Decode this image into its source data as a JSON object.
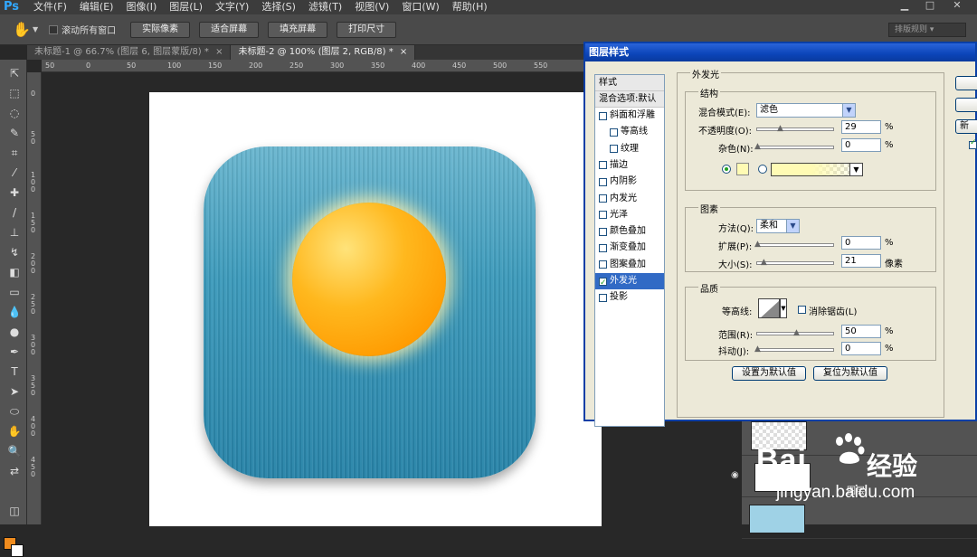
{
  "app": {
    "logo": "Ps",
    "win_min": "▁",
    "win_max": "□",
    "win_close": "✕"
  },
  "menu": [
    "文件(F)",
    "编辑(E)",
    "图像(I)",
    "图层(L)",
    "文字(Y)",
    "选择(S)",
    "滤镜(T)",
    "视图(V)",
    "窗口(W)",
    "帮助(H)"
  ],
  "options": {
    "scroll_all_windows": "滚动所有窗口",
    "actual_pixels": "实际像素",
    "fit_screen": "适合屏幕",
    "fill_screen": "填充屏幕",
    "print_size": "打印尺寸",
    "workspace": "排版规则"
  },
  "tabs": [
    {
      "label": "未标题-1 @ 66.7% (图层 6, 图层蒙版/8) *",
      "close": "×",
      "active": false
    },
    {
      "label": "未标题-2 @ 100% (图层 2, RGB/8) *",
      "close": "×",
      "active": true
    }
  ],
  "ruler": {
    "top": [
      "50",
      "0",
      "50",
      "100",
      "150",
      "200",
      "250",
      "300",
      "350",
      "400",
      "450",
      "500",
      "550"
    ],
    "left": [
      "0",
      "5 0",
      "1 0 0",
      "1 5 0",
      "2 0 0",
      "2 5 0",
      "3 0 0",
      "3 5 0",
      "4 0 0",
      "4 5 0"
    ]
  },
  "colors": {
    "foreground": "#f08c1e",
    "background": "#ffffff",
    "tile": "#2f8db3",
    "sun": "#ffa60a"
  },
  "dialog": {
    "title": "图层样式",
    "styles_header": "样式",
    "blend_options": "混合选项:默认",
    "styles": [
      {
        "label": "斜面和浮雕",
        "checked": false,
        "sub": false,
        "selected": false
      },
      {
        "label": "等高线",
        "checked": false,
        "sub": true,
        "selected": false
      },
      {
        "label": "纹理",
        "checked": false,
        "sub": true,
        "selected": false
      },
      {
        "label": "描边",
        "checked": false,
        "sub": false,
        "selected": false
      },
      {
        "label": "内阴影",
        "checked": false,
        "sub": false,
        "selected": false
      },
      {
        "label": "内发光",
        "checked": false,
        "sub": false,
        "selected": false
      },
      {
        "label": "光泽",
        "checked": false,
        "sub": false,
        "selected": false
      },
      {
        "label": "颜色叠加",
        "checked": false,
        "sub": false,
        "selected": false
      },
      {
        "label": "渐变叠加",
        "checked": false,
        "sub": false,
        "selected": false
      },
      {
        "label": "图案叠加",
        "checked": false,
        "sub": false,
        "selected": false
      },
      {
        "label": "外发光",
        "checked": true,
        "sub": false,
        "selected": true
      },
      {
        "label": "投影",
        "checked": false,
        "sub": false,
        "selected": false
      }
    ],
    "section_title": "外发光",
    "structure": {
      "title": "结构",
      "blend_mode_label": "混合模式(E):",
      "blend_mode_value": "滤色",
      "opacity_label": "不透明度(O):",
      "opacity_value": "29",
      "opacity_fraction": 0.29,
      "noise_label": "杂色(N):",
      "noise_value": "0",
      "noise_fraction": 0.0,
      "percent": "%",
      "glow_color": "#fffbb4"
    },
    "elements": {
      "title": "图素",
      "method_label": "方法(Q):",
      "method_value": "柔和",
      "spread_label": "扩展(P):",
      "spread_value": "0",
      "spread_fraction": 0.0,
      "size_label": "大小(S):",
      "size_value": "21",
      "size_fraction": 0.08,
      "px_unit": "像素",
      "percent": "%"
    },
    "quality": {
      "title": "品质",
      "contour_label": "等高线:",
      "antialias_label": "消除锯齿(L)",
      "range_label": "范围(R):",
      "range_value": "50",
      "range_fraction": 0.5,
      "jitter_label": "抖动(J):",
      "jitter_value": "0",
      "jitter_fraction": 0.0,
      "percent": "%"
    },
    "set_default": "设置为默认值",
    "reset_default": "复位为默认值",
    "side_new": "新"
  },
  "layers": {
    "layer_name": "图层"
  },
  "watermark": {
    "brand": "Bai",
    "brand_suffix": "经验",
    "url": "jingyan.baidu.com"
  }
}
